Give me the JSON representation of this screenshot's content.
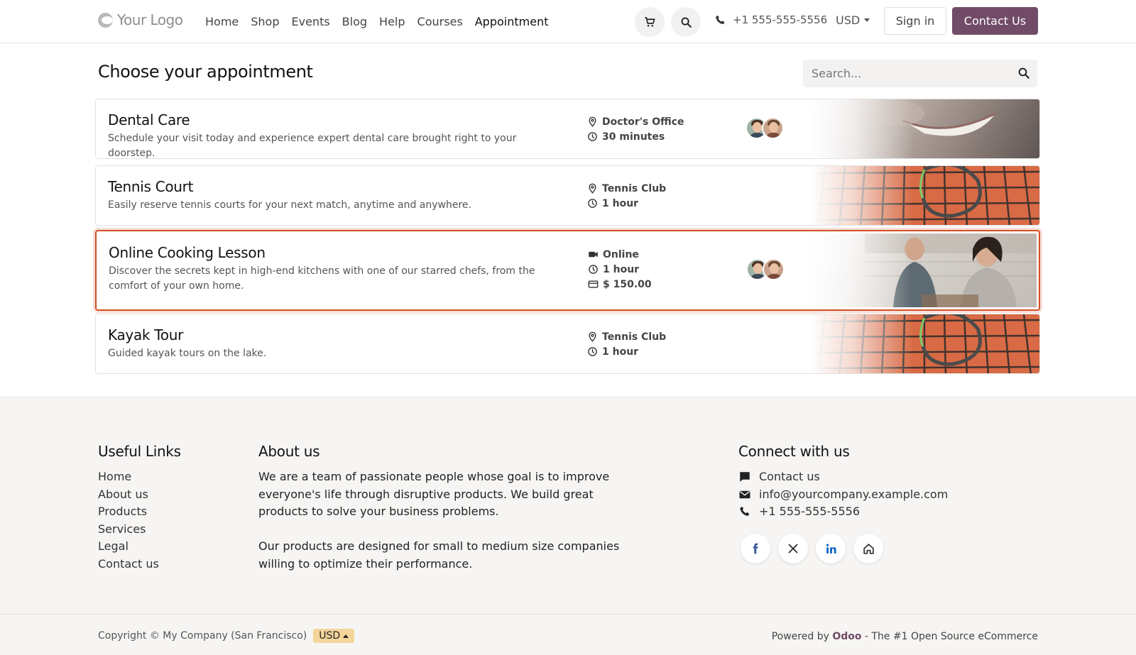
{
  "header": {
    "logo_text": "Your Logo",
    "nav": [
      "Home",
      "Shop",
      "Events",
      "Blog",
      "Help",
      "Courses",
      "Appointment"
    ],
    "active_nav": "Appointment",
    "phone": "+1 555-555-5556",
    "currency": "USD",
    "sign_in": "Sign in",
    "contact_us": "Contact Us",
    "accent_color": "#714b67"
  },
  "main": {
    "title": "Choose your appointment",
    "search_placeholder": "Search...",
    "appointments": [
      {
        "title": "Dental Care",
        "description": "Schedule your visit today and experience expert dental care brought right to your doorstep.",
        "location": "Doctor's Office",
        "duration": "30 minutes",
        "has_staff": true,
        "image": "smile"
      },
      {
        "title": "Tennis Court",
        "description": "Easily reserve tennis courts for your next match, anytime and anywhere.",
        "location": "Tennis Club",
        "duration": "1 hour",
        "has_staff": false,
        "image": "tennis"
      },
      {
        "title": "Online Cooking Lesson",
        "description": "Discover the secrets kept in high-end kitchens with one of our starred chefs, from the comfort of your own home.",
        "location": "Online",
        "duration": "1 hour",
        "price": "$ 150.00",
        "has_staff": true,
        "selected": true,
        "image": "kitchen"
      },
      {
        "title": "Kayak Tour",
        "description": "Guided kayak tours on the lake.",
        "location": "Tennis Club",
        "duration": "1 hour",
        "has_staff": false,
        "image": "tennis"
      }
    ]
  },
  "footer": {
    "useful_links_title": "Useful Links",
    "useful_links": [
      "Home",
      "About us",
      "Products",
      "Services",
      "Legal",
      "Contact us"
    ],
    "about_title": "About us",
    "about_p1": "We are a team of passionate people whose goal is to improve everyone's life through disruptive products. We build great products to solve your business problems.",
    "about_p2": "Our products are designed for small to medium size companies willing to optimize their performance.",
    "connect_title": "Connect with us",
    "connect_contact": "Contact us",
    "connect_email": "info@yourcompany.example.com",
    "connect_phone": "+1 555-555-5556",
    "socials": [
      "facebook-icon",
      "x-icon",
      "linkedin-icon",
      "home-icon"
    ]
  },
  "bottom": {
    "copyright": "Copyright © My Company (San Francisco)",
    "currency_badge": "USD",
    "powered_by": "Powered by",
    "odoo": "Odoo",
    "tagline_mid": " - The #1 ",
    "tagline_end": "Open Source eCommerce"
  }
}
